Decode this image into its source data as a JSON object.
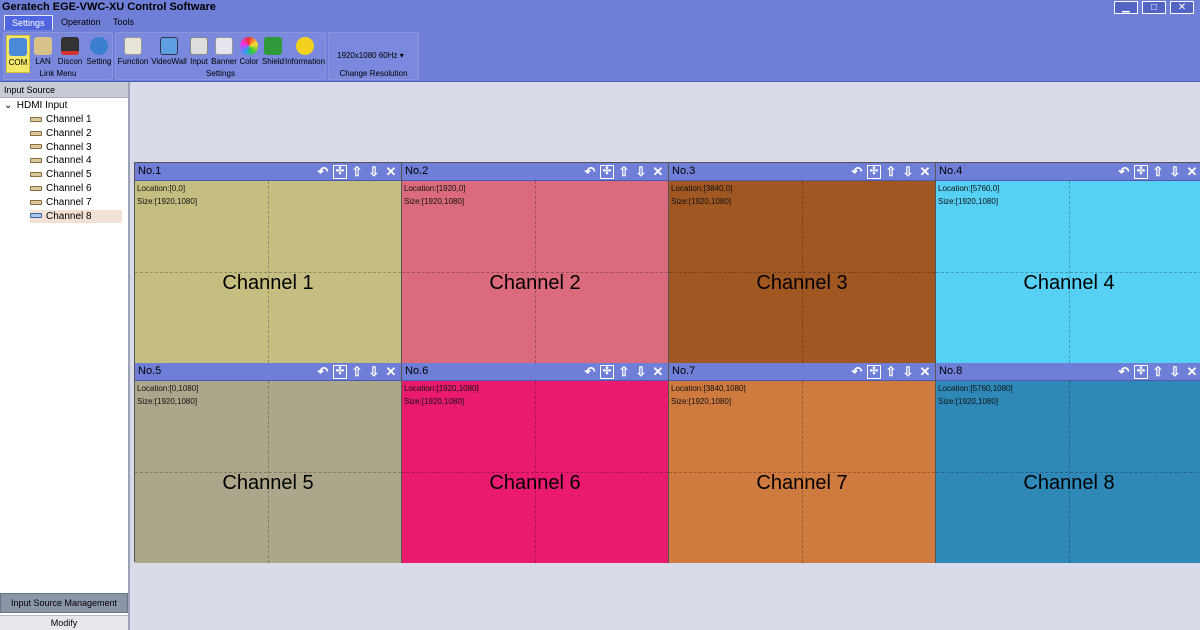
{
  "window": {
    "title": "Geratech EGE-VWC-XU Control Software",
    "controls": [
      "▁",
      "□",
      "✕"
    ]
  },
  "menu": {
    "tabs": [
      "Settings",
      "Operation",
      "Tools"
    ],
    "active": "Settings"
  },
  "ribbon": {
    "link_menu": {
      "label": "Link Menu",
      "buttons": [
        {
          "label": "COM",
          "icon": "com-port-icon",
          "active": true
        },
        {
          "label": "LAN",
          "icon": "lan-icon"
        },
        {
          "label": "Discon",
          "icon": "disconnect-icon"
        },
        {
          "label": "Setting",
          "icon": "setting-globe-icon"
        }
      ]
    },
    "settings": {
      "label": "Settings",
      "buttons": [
        {
          "label": "Function",
          "icon": "function-icon"
        },
        {
          "label": "VideoWall",
          "icon": "videowall-icon"
        },
        {
          "label": "Input",
          "icon": "input-icon"
        },
        {
          "label": "Banner",
          "icon": "banner-icon"
        },
        {
          "label": "Color",
          "icon": "color-icon"
        },
        {
          "label": "Shield",
          "icon": "shield-icon"
        },
        {
          "label": "Information",
          "icon": "information-icon"
        }
      ]
    },
    "resolution": {
      "label": "Change Resolution",
      "value": "1920x1080 60Hz",
      "dropdown": "▾"
    }
  },
  "left_panel": {
    "header": "Input Source",
    "tree": {
      "root": "HDMI Input",
      "caret": "⌄",
      "items": [
        "Channel 1",
        "Channel 2",
        "Channel 3",
        "Channel 4",
        "Channel 5",
        "Channel 6",
        "Channel 7",
        "Channel 8"
      ],
      "selected": "Channel 8"
    },
    "footer_tab": "Input Source Management",
    "footer_button": "Modify"
  },
  "wall": {
    "tool_icons": [
      "↶",
      "✣",
      "⇧",
      "⇩",
      "✕"
    ],
    "windows": [
      {
        "no": "No.1",
        "location": "Location:[0,0]",
        "size": "Size:[1920,1080]",
        "channel": "Channel 1",
        "color": "#c4bf80"
      },
      {
        "no": "No.2",
        "location": "Location:[1920,0]",
        "size": "Size:[1920,1080]",
        "channel": "Channel 2",
        "color": "#da6a7c"
      },
      {
        "no": "No.3",
        "location": "Location:[3840,0]",
        "size": "Size:[1920,1080]",
        "channel": "Channel 3",
        "color": "#a15722"
      },
      {
        "no": "No.4",
        "location": "Location:[5760,0]",
        "size": "Size:[1920,1080]",
        "channel": "Channel 4",
        "color": "#56d0f4"
      },
      {
        "no": "No.5",
        "location": "Location:[0,1080]",
        "size": "Size:[1920,1080]",
        "channel": "Channel 5",
        "color": "#aca68a"
      },
      {
        "no": "No.6",
        "location": "Location:[1920,1080]",
        "size": "Size:[1920,1080]",
        "channel": "Channel 6",
        "color": "#ea1b6e"
      },
      {
        "no": "No.7",
        "location": "Location:[3840,1080]",
        "size": "Size:[1920,1080]",
        "channel": "Channel 7",
        "color": "#cf7a3e"
      },
      {
        "no": "No.8",
        "location": "Location:[5760,1080]",
        "size": "Size:[1920,1080]",
        "channel": "Channel 8",
        "color": "#2e89b8"
      }
    ]
  }
}
